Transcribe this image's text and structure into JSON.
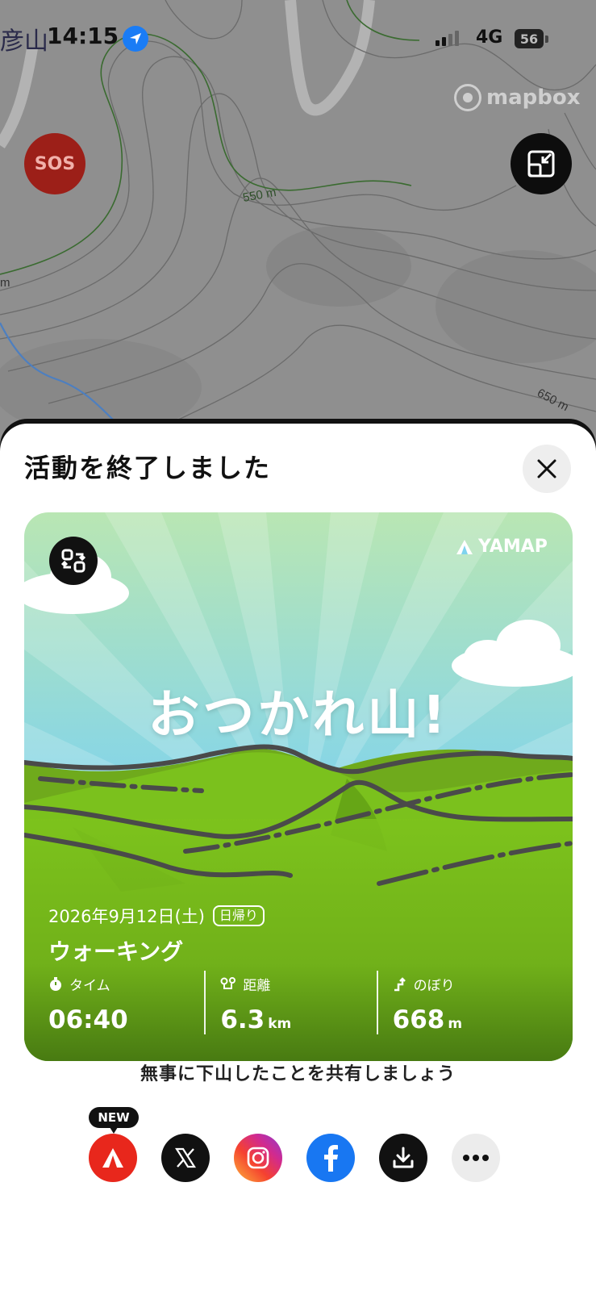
{
  "status_bar": {
    "time": "14:15",
    "network": "4G",
    "battery": "56"
  },
  "map": {
    "place_label": "彦山",
    "contour_labels": [
      "550 m",
      "650 m",
      "m"
    ],
    "attribution": "mapbox",
    "sos_label": "SOS",
    "icons": {
      "location": "location-arrow-icon",
      "collapse": "collapse-icon"
    }
  },
  "sheet": {
    "title": "活動を終了しました",
    "close_icon": "close-icon",
    "card": {
      "brand": "YAMAP",
      "headline": "おつかれ山!",
      "date": "2026年9月12日(土)",
      "day_type": "日帰り",
      "activity": "ウォーキング",
      "stats": [
        {
          "label": "タイム",
          "value": "06:40",
          "unit": "",
          "icon": "stopwatch-icon"
        },
        {
          "label": "距離",
          "value": "6.3",
          "unit": "km",
          "icon": "route-icon"
        },
        {
          "label": "のぼり",
          "value": "668",
          "unit": "m",
          "icon": "ascent-icon"
        }
      ]
    },
    "share_prompt": "無事に下山したことを共有しましょう",
    "share": {
      "new_badge": "NEW",
      "targets": [
        "yamap",
        "x",
        "instagram",
        "facebook",
        "download",
        "more"
      ]
    },
    "colors": {
      "yamap_red": "#e8271c",
      "facebook_blue": "#1877f2",
      "sky_top": "#b9e6b3",
      "sky_bottom": "#6ec7ef",
      "grass": "#7cc21a"
    }
  }
}
